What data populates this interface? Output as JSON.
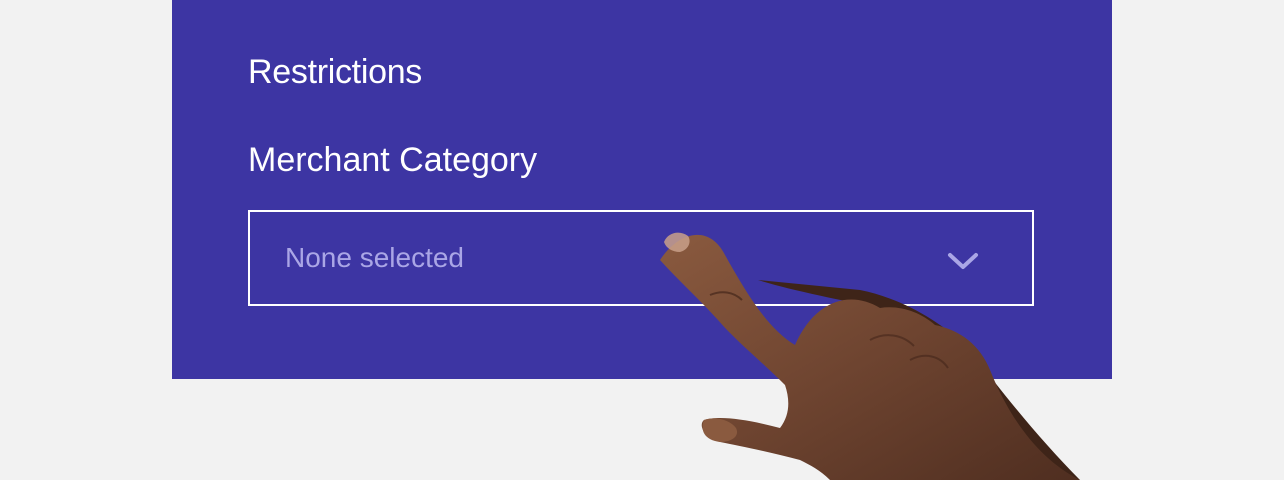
{
  "restrictions": {
    "title": "Restrictions",
    "merchant_category": {
      "label": "Merchant Category",
      "selected_value": "None selected",
      "chevron_icon": "chevron-down-icon"
    }
  },
  "colors": {
    "background": "#f2f2f2",
    "panel": "#3d35a3",
    "text": "#ffffff",
    "placeholder": "#aaa6e6",
    "border": "#ffffff"
  }
}
